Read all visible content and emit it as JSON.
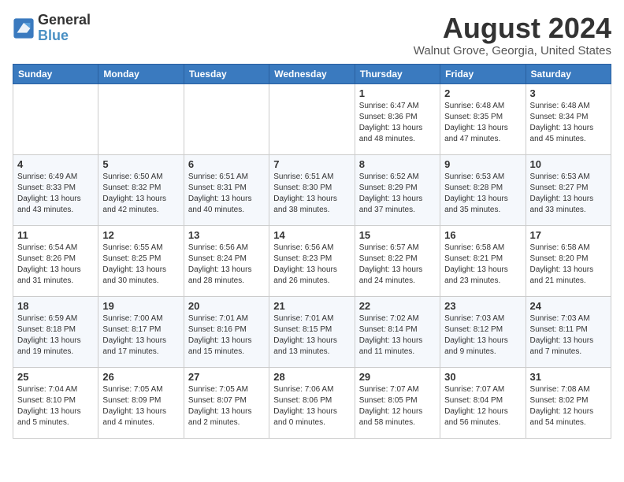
{
  "logo": {
    "line1": "General",
    "line2": "Blue"
  },
  "title": "August 2024",
  "subtitle": "Walnut Grove, Georgia, United States",
  "days_of_week": [
    "Sunday",
    "Monday",
    "Tuesday",
    "Wednesday",
    "Thursday",
    "Friday",
    "Saturday"
  ],
  "weeks": [
    [
      {
        "day": "",
        "info": ""
      },
      {
        "day": "",
        "info": ""
      },
      {
        "day": "",
        "info": ""
      },
      {
        "day": "",
        "info": ""
      },
      {
        "day": "1",
        "info": "Sunrise: 6:47 AM\nSunset: 8:36 PM\nDaylight: 13 hours\nand 48 minutes."
      },
      {
        "day": "2",
        "info": "Sunrise: 6:48 AM\nSunset: 8:35 PM\nDaylight: 13 hours\nand 47 minutes."
      },
      {
        "day": "3",
        "info": "Sunrise: 6:48 AM\nSunset: 8:34 PM\nDaylight: 13 hours\nand 45 minutes."
      }
    ],
    [
      {
        "day": "4",
        "info": "Sunrise: 6:49 AM\nSunset: 8:33 PM\nDaylight: 13 hours\nand 43 minutes."
      },
      {
        "day": "5",
        "info": "Sunrise: 6:50 AM\nSunset: 8:32 PM\nDaylight: 13 hours\nand 42 minutes."
      },
      {
        "day": "6",
        "info": "Sunrise: 6:51 AM\nSunset: 8:31 PM\nDaylight: 13 hours\nand 40 minutes."
      },
      {
        "day": "7",
        "info": "Sunrise: 6:51 AM\nSunset: 8:30 PM\nDaylight: 13 hours\nand 38 minutes."
      },
      {
        "day": "8",
        "info": "Sunrise: 6:52 AM\nSunset: 8:29 PM\nDaylight: 13 hours\nand 37 minutes."
      },
      {
        "day": "9",
        "info": "Sunrise: 6:53 AM\nSunset: 8:28 PM\nDaylight: 13 hours\nand 35 minutes."
      },
      {
        "day": "10",
        "info": "Sunrise: 6:53 AM\nSunset: 8:27 PM\nDaylight: 13 hours\nand 33 minutes."
      }
    ],
    [
      {
        "day": "11",
        "info": "Sunrise: 6:54 AM\nSunset: 8:26 PM\nDaylight: 13 hours\nand 31 minutes."
      },
      {
        "day": "12",
        "info": "Sunrise: 6:55 AM\nSunset: 8:25 PM\nDaylight: 13 hours\nand 30 minutes."
      },
      {
        "day": "13",
        "info": "Sunrise: 6:56 AM\nSunset: 8:24 PM\nDaylight: 13 hours\nand 28 minutes."
      },
      {
        "day": "14",
        "info": "Sunrise: 6:56 AM\nSunset: 8:23 PM\nDaylight: 13 hours\nand 26 minutes."
      },
      {
        "day": "15",
        "info": "Sunrise: 6:57 AM\nSunset: 8:22 PM\nDaylight: 13 hours\nand 24 minutes."
      },
      {
        "day": "16",
        "info": "Sunrise: 6:58 AM\nSunset: 8:21 PM\nDaylight: 13 hours\nand 23 minutes."
      },
      {
        "day": "17",
        "info": "Sunrise: 6:58 AM\nSunset: 8:20 PM\nDaylight: 13 hours\nand 21 minutes."
      }
    ],
    [
      {
        "day": "18",
        "info": "Sunrise: 6:59 AM\nSunset: 8:18 PM\nDaylight: 13 hours\nand 19 minutes."
      },
      {
        "day": "19",
        "info": "Sunrise: 7:00 AM\nSunset: 8:17 PM\nDaylight: 13 hours\nand 17 minutes."
      },
      {
        "day": "20",
        "info": "Sunrise: 7:01 AM\nSunset: 8:16 PM\nDaylight: 13 hours\nand 15 minutes."
      },
      {
        "day": "21",
        "info": "Sunrise: 7:01 AM\nSunset: 8:15 PM\nDaylight: 13 hours\nand 13 minutes."
      },
      {
        "day": "22",
        "info": "Sunrise: 7:02 AM\nSunset: 8:14 PM\nDaylight: 13 hours\nand 11 minutes."
      },
      {
        "day": "23",
        "info": "Sunrise: 7:03 AM\nSunset: 8:12 PM\nDaylight: 13 hours\nand 9 minutes."
      },
      {
        "day": "24",
        "info": "Sunrise: 7:03 AM\nSunset: 8:11 PM\nDaylight: 13 hours\nand 7 minutes."
      }
    ],
    [
      {
        "day": "25",
        "info": "Sunrise: 7:04 AM\nSunset: 8:10 PM\nDaylight: 13 hours\nand 5 minutes."
      },
      {
        "day": "26",
        "info": "Sunrise: 7:05 AM\nSunset: 8:09 PM\nDaylight: 13 hours\nand 4 minutes."
      },
      {
        "day": "27",
        "info": "Sunrise: 7:05 AM\nSunset: 8:07 PM\nDaylight: 13 hours\nand 2 minutes."
      },
      {
        "day": "28",
        "info": "Sunrise: 7:06 AM\nSunset: 8:06 PM\nDaylight: 13 hours\nand 0 minutes."
      },
      {
        "day": "29",
        "info": "Sunrise: 7:07 AM\nSunset: 8:05 PM\nDaylight: 12 hours\nand 58 minutes."
      },
      {
        "day": "30",
        "info": "Sunrise: 7:07 AM\nSunset: 8:04 PM\nDaylight: 12 hours\nand 56 minutes."
      },
      {
        "day": "31",
        "info": "Sunrise: 7:08 AM\nSunset: 8:02 PM\nDaylight: 12 hours\nand 54 minutes."
      }
    ]
  ]
}
